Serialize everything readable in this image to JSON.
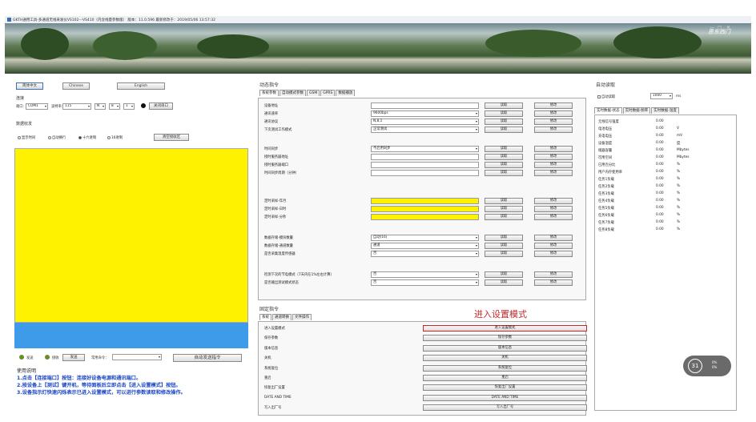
{
  "window": {
    "title": "GKTH通用工具-多通道无线采发仪VS102---VS410（内含线量参数版）  版本：11.0.596  最新修改于：2019/05/06 13:57:32"
  },
  "banner": {
    "logo_text": "思东西门"
  },
  "left": {
    "lang_buttons": [
      "简体中文",
      "Chinese",
      "English"
    ],
    "connect_label": "连接",
    "port_label": "端口：",
    "port_value": "COM1",
    "baud_label": "波特率：",
    "baud_value": "115",
    "parity_value": "N",
    "databits_value": "8",
    "stopbits_value": "1",
    "open_button": "关闭串口",
    "data_label": "数据收发",
    "options": [
      "显示时间",
      "自动换行",
      "十六进制",
      "16进制"
    ],
    "clear_button": "清空接收区",
    "bottom": {
      "lamp1_label": "发送",
      "lamp2_label": "接收",
      "send_button": "发送",
      "cmd_label": "常用命令：",
      "cmd_value": "",
      "big_button": "自动发送指令"
    },
    "usage_title": "使用说明",
    "usage": [
      "1.点击【连接端口】按钮：连接好设备电源和通讯端口。",
      "2.按设备上【测试】键开机，等待面板后立即点击【进入设置模式】按钮。",
      "3.设备指示灯快速闪烁表示已进入设置模式，可以进行参数读取和修改操作。"
    ]
  },
  "mid": {
    "dyn_title": "动态指令",
    "dyn_tabs": [
      "系统参数",
      "自动模式参数",
      "GSM",
      "GPRS",
      "数据播放"
    ],
    "read_label": "读取",
    "write_label": "修改",
    "rows": [
      {
        "name": "设备地址",
        "value": ""
      },
      {
        "name": "通讯速率",
        "value": "9600bps"
      },
      {
        "name": "通讯协议",
        "value": "N,8,1"
      },
      {
        "name": "下次测试工作模式",
        "value": "正常测试"
      },
      {
        "name": "时间同步",
        "value": "不启用同步"
      },
      {
        "name": "授时服务器地址",
        "value": ""
      },
      {
        "name": "授时服务器端口",
        "value": ""
      },
      {
        "name": "时间同步周期（分钟）",
        "value": ""
      },
      {
        "name": "定时采样-年月",
        "value": ""
      },
      {
        "name": "定时采样-日时",
        "value": ""
      },
      {
        "name": "定时采样-分秒",
        "value": ""
      },
      {
        "name": "数据存储-模块数量",
        "value": "自动(16)"
      },
      {
        "name": "数据存储-通道数量",
        "value": "通道"
      },
      {
        "name": "是否采集温度传感器",
        "value": "否"
      },
      {
        "name": "检测下次的节电模式（7天内在1%左右计算）",
        "value": "否"
      },
      {
        "name": "是否输出测试模式状态",
        "value": "否"
      }
    ],
    "fixed_title": "固定指令",
    "fixed_tabs": [
      "系统",
      "通道转换",
      "文件操作"
    ],
    "annotation": "进入设置模式",
    "fixed": [
      {
        "name": "进入设置模式",
        "button": "进入设置模式"
      },
      {
        "name": "保存参数",
        "button": "保存参数"
      },
      {
        "name": "版本信息",
        "button": "版本信息"
      },
      {
        "name": "关机",
        "button": "关机"
      },
      {
        "name": "系统复位",
        "button": "系统复位"
      },
      {
        "name": "重启",
        "button": "重启"
      },
      {
        "name": "恢复出厂设置",
        "button": "恢复出厂设置"
      },
      {
        "name": "DATE AND TIME",
        "button": "DATE AND TIME"
      },
      {
        "name": "写入出厂号",
        "button": "写入出厂号"
      }
    ]
  },
  "right": {
    "title": "自动读取",
    "auto_label": "自动读取",
    "interval_value": "1000",
    "interval_unit": "ms",
    "tabs": [
      "实时数据-状态",
      "实时数据-频率",
      "实时数据-温度"
    ],
    "rows": [
      {
        "k": "无线信号强度",
        "v": "0.00",
        "u": ""
      },
      {
        "k": "电池电压",
        "v": "0.00",
        "u": "V"
      },
      {
        "k": "充电电压",
        "v": "0.00",
        "u": "mV"
      },
      {
        "k": "设备温度",
        "v": "0.00",
        "u": "度"
      },
      {
        "k": "储器容量",
        "v": "0.00",
        "u": "Mbytes"
      },
      {
        "k": "可用空间",
        "v": "0.00",
        "u": "Mbytes"
      },
      {
        "k": "已用百分比",
        "v": "0.00",
        "u": "%"
      },
      {
        "k": "用户内存使用率",
        "v": "0.00",
        "u": "%"
      },
      {
        "k": "任务1负载",
        "v": "0.00",
        "u": "%"
      },
      {
        "k": "任务2负载",
        "v": "0.00",
        "u": "%"
      },
      {
        "k": "任务3负载",
        "v": "0.00",
        "u": "%"
      },
      {
        "k": "任务4负载",
        "v": "0.00",
        "u": "%"
      },
      {
        "k": "任务5负载",
        "v": "0.00",
        "u": "%"
      },
      {
        "k": "任务6负载",
        "v": "0.00",
        "u": "%"
      },
      {
        "k": "任务7负载",
        "v": "0.00",
        "u": "%"
      },
      {
        "k": "任务8负载",
        "v": "0.00",
        "u": "%"
      }
    ]
  },
  "clock": {
    "big": "31",
    "small1": "0%",
    "small2": "0%"
  },
  "colors": {
    "yellow": "#fff200",
    "blue": "#3d9be9",
    "annotation": "#c62828",
    "usage": "#1a47c8"
  }
}
